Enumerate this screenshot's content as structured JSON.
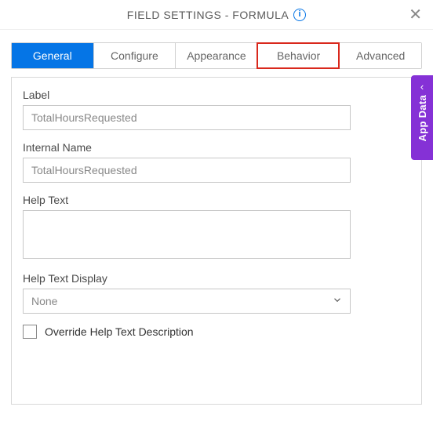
{
  "header": {
    "title": "FIELD SETTINGS - FORMULA",
    "info_icon": "i",
    "close_icon": "✕"
  },
  "tabs": [
    {
      "label": "General",
      "active": true,
      "highlighted": false
    },
    {
      "label": "Configure",
      "active": false,
      "highlighted": false
    },
    {
      "label": "Appearance",
      "active": false,
      "highlighted": false
    },
    {
      "label": "Behavior",
      "active": false,
      "highlighted": true
    },
    {
      "label": "Advanced",
      "active": false,
      "highlighted": false
    }
  ],
  "form": {
    "label": {
      "label": "Label",
      "value": "TotalHoursRequested"
    },
    "internal_name": {
      "label": "Internal Name",
      "value": "TotalHoursRequested"
    },
    "help_text": {
      "label": "Help Text",
      "value": ""
    },
    "help_text_display": {
      "label": "Help Text Display",
      "value": "None"
    },
    "override": {
      "label": "Override Help Text Description",
      "checked": false
    }
  },
  "side_tab": {
    "label": "App Data",
    "chevron": "‹"
  }
}
